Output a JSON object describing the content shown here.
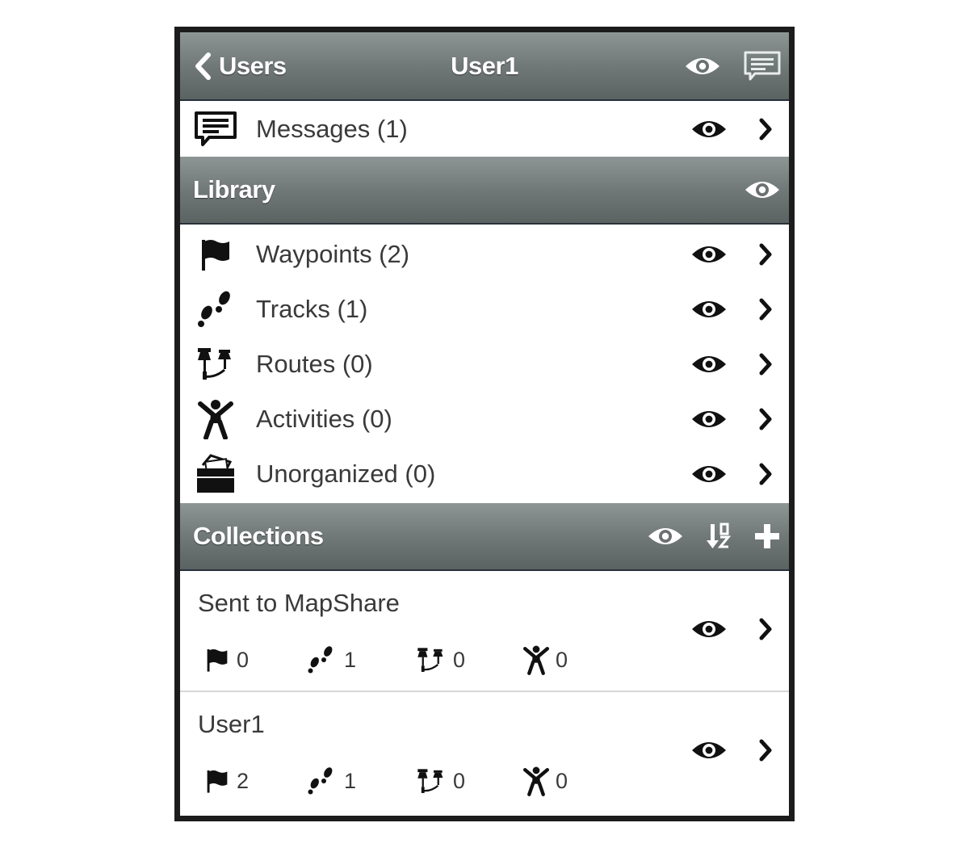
{
  "header": {
    "back_label": "Users",
    "title": "User1",
    "icons": [
      "eye-icon",
      "message-icon"
    ]
  },
  "messages": {
    "label": "Messages (1)",
    "icon": "message-icon"
  },
  "library": {
    "title": "Library",
    "items": [
      {
        "label": "Waypoints (2)",
        "icon": "flag-icon"
      },
      {
        "label": "Tracks (1)",
        "icon": "footprints-icon"
      },
      {
        "label": "Routes (0)",
        "icon": "pushpins-icon"
      },
      {
        "label": "Activities (0)",
        "icon": "person-icon"
      },
      {
        "label": "Unorganized (0)",
        "icon": "folder-icon"
      }
    ]
  },
  "collections": {
    "title": "Collections",
    "icons": [
      "eye-icon",
      "sort-icon",
      "plus-icon"
    ],
    "items": [
      {
        "name": "Sent to MapShare",
        "waypoints": "0",
        "tracks": "1",
        "routes": "0",
        "activities": "0"
      },
      {
        "name": "User1",
        "waypoints": "2",
        "tracks": "1",
        "routes": "0",
        "activities": "0"
      }
    ]
  },
  "colors": {
    "bar_gradient_top": "#8e9595",
    "bar_gradient_bottom": "#5b6262",
    "text": "#3a3a3a",
    "icon": "#111111"
  }
}
